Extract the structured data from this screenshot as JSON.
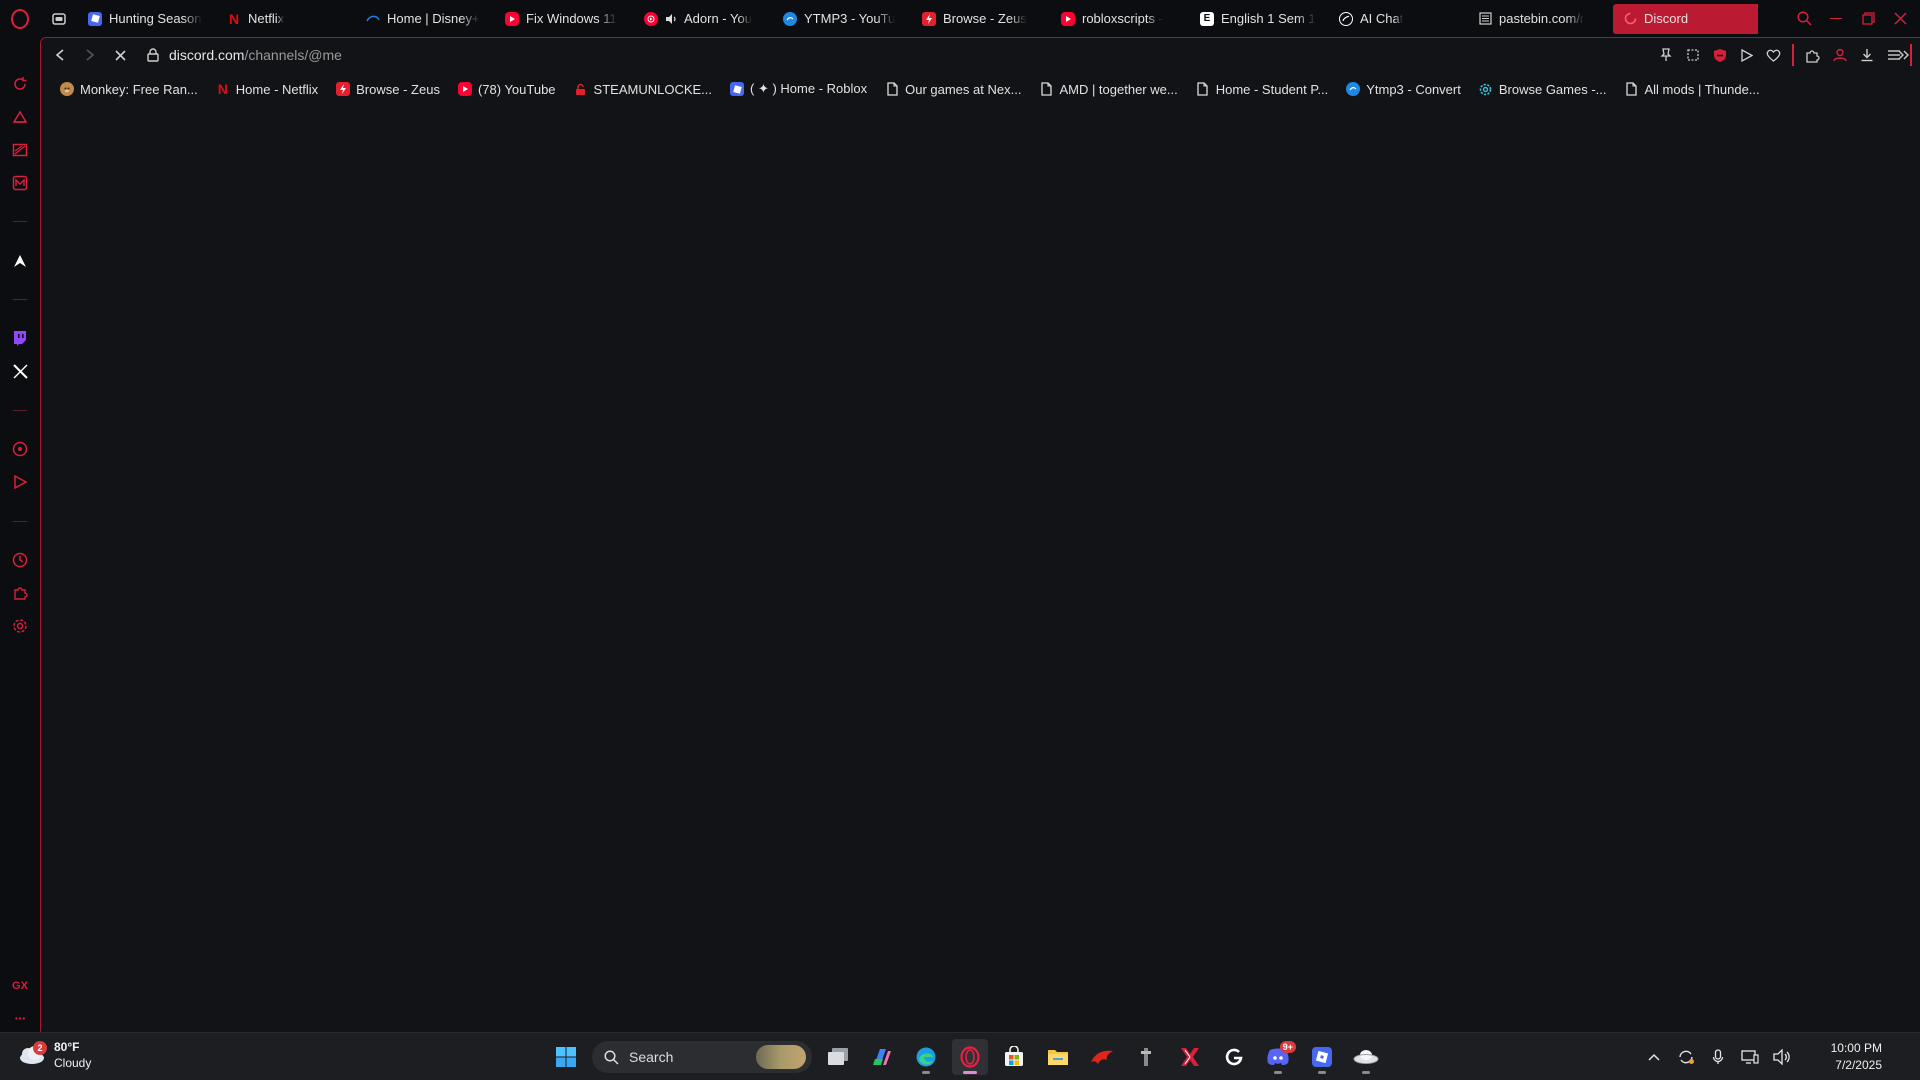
{
  "tabs": [
    {
      "label": "Hunting Season",
      "icon": "roblox-icon",
      "color": "#4668f0"
    },
    {
      "label": "Netflix",
      "icon": "netflix-icon",
      "color": "#e50914"
    },
    {
      "label": "Home | Disney+",
      "icon": "disney-icon",
      "color": "#1f80e0"
    },
    {
      "label": "Fix Windows 11",
      "icon": "youtube-icon",
      "color": "#ff0033"
    },
    {
      "label": "Adorn - You",
      "icon": "youtube-music-icon",
      "color": "#ff0033",
      "audio": true
    },
    {
      "label": "YTMP3 - YouTu",
      "icon": "ytmp3-icon",
      "color": "#1e88e5"
    },
    {
      "label": "Browse - Zeus",
      "icon": "zeus-icon",
      "color": "#e4202e"
    },
    {
      "label": "robloxscripts -",
      "icon": "youtube-icon",
      "color": "#ff0033"
    },
    {
      "label": "English 1 Sem 1",
      "icon": "edgenuity-icon",
      "color": "#ffffff"
    },
    {
      "label": "AI Chat",
      "icon": "ai-chat-icon",
      "color": "#ffffff"
    },
    {
      "label": "pastebin.com/r",
      "icon": "pastebin-icon",
      "color": "#d0d0d0"
    },
    {
      "label": "Discord",
      "icon": "loading-icon",
      "color": "#ff5c74",
      "active": true
    }
  ],
  "address": {
    "domain": "discord.com",
    "path": "/channels/@me"
  },
  "bookmarks": [
    {
      "label": "Monkey: Free Ran...",
      "icon": "monkey-icon",
      "color": "#c08a4a"
    },
    {
      "label": "Home - Netflix",
      "icon": "netflix-icon",
      "color": "#e50914"
    },
    {
      "label": "Browse - Zeus",
      "icon": "zeus-icon",
      "color": "#e4202e"
    },
    {
      "label": "(78) YouTube",
      "icon": "youtube-icon",
      "color": "#ff0033"
    },
    {
      "label": "STEAMUNLOCKE...",
      "icon": "steamunlocked-icon",
      "color": "#e0202c"
    },
    {
      "label": "( ✦ ) Home - Roblox",
      "icon": "roblox-icon",
      "color": "#4668f0"
    },
    {
      "label": "Our games at Nex...",
      "icon": "file-icon",
      "color": "#dddddd"
    },
    {
      "label": "AMD | together we...",
      "icon": "file-icon",
      "color": "#dddddd"
    },
    {
      "label": "Home - Student P...",
      "icon": "file-icon",
      "color": "#dddddd"
    },
    {
      "label": "Ytmp3 - Convert",
      "icon": "ytmp3-icon",
      "color": "#1e88e5"
    },
    {
      "label": "Browse Games -...",
      "icon": "gear-icon",
      "color": "#3cc6e0"
    },
    {
      "label": "All mods | Thunde...",
      "icon": "file-icon",
      "color": "#dddddd"
    }
  ],
  "sidebar": {
    "gx_label": "GX",
    "more_label": "···"
  },
  "taskbar": {
    "weather_temp": "80°F",
    "weather_desc": "Cloudy",
    "weather_badge": "2",
    "search_label": "Search",
    "discord_badge": "9+",
    "time": "10:00 PM",
    "date": "7/2/2025"
  },
  "colors": {
    "accent": "#d81f3c",
    "active_tab": "#bb1a33",
    "background": "#121316"
  }
}
